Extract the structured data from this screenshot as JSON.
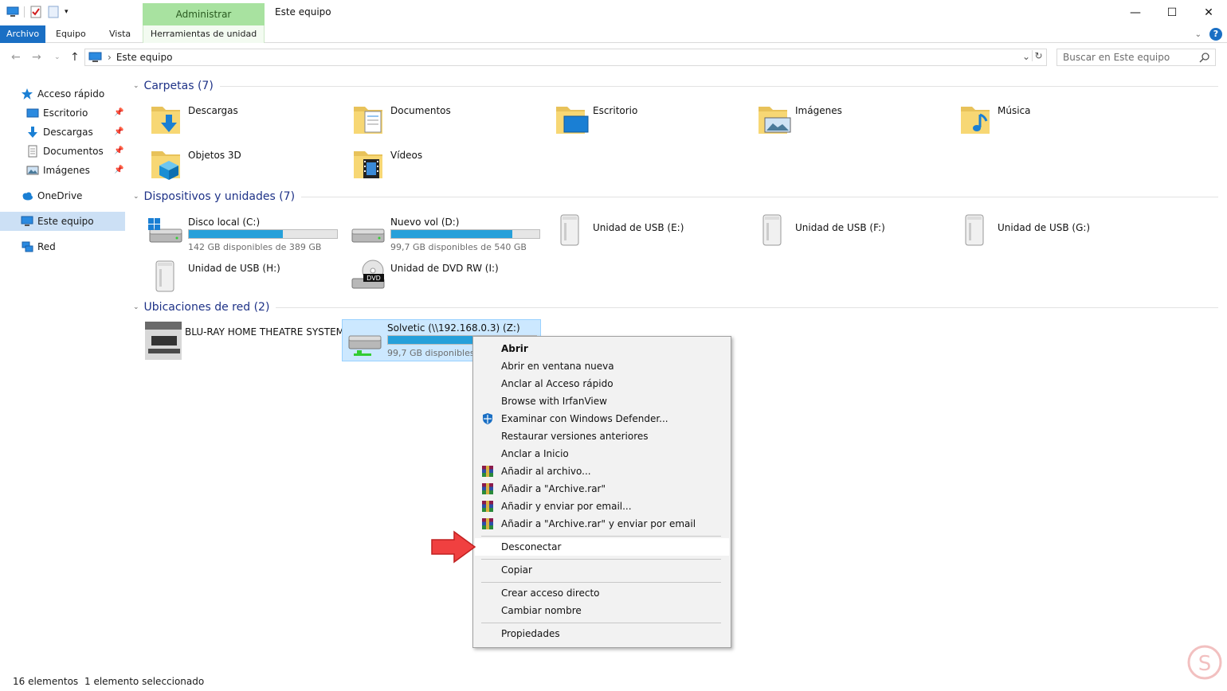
{
  "window": {
    "title": "Este equipo",
    "context_tab_group": "Administrar",
    "minimize": "—",
    "maximize": "☐",
    "close": "✕"
  },
  "ribbon": {
    "tabs": [
      "Archivo",
      "Equipo",
      "Vista",
      "Herramientas de unidad"
    ],
    "help": "?"
  },
  "address": {
    "path": "Este equipo",
    "search_placeholder": "Buscar en Este equipo"
  },
  "sidebar": {
    "items": [
      {
        "label": "Acceso rápido"
      },
      {
        "label": "Escritorio"
      },
      {
        "label": "Descargas"
      },
      {
        "label": "Documentos"
      },
      {
        "label": "Imágenes"
      },
      {
        "label": "OneDrive"
      },
      {
        "label": "Este equipo"
      },
      {
        "label": "Red"
      }
    ]
  },
  "groups": {
    "folders": {
      "header": "Carpetas (7)",
      "items": [
        "Descargas",
        "Documentos",
        "Escritorio",
        "Imágenes",
        "Música",
        "Objetos 3D",
        "Vídeos"
      ]
    },
    "devices": {
      "header": "Dispositivos y unidades (7)",
      "items": [
        {
          "name": "Disco local (C:)",
          "free": "142 GB disponibles de 389 GB",
          "used_fraction": 0.635
        },
        {
          "name": "Nuevo vol (D:)",
          "free": "99,7 GB disponibles de 540 GB",
          "used_fraction": 0.815
        },
        {
          "name": "Unidad de USB (E:)"
        },
        {
          "name": "Unidad de USB (F:)"
        },
        {
          "name": "Unidad de USB (G:)"
        },
        {
          "name": "Unidad de USB (H:)"
        },
        {
          "name": "Unidad de DVD RW (I:)"
        }
      ]
    },
    "network": {
      "header": "Ubicaciones de red (2)",
      "items": [
        {
          "name": "BLU-RAY HOME THEATRE SYSTEM"
        },
        {
          "name": "Solvetic (\\\\192.168.0.3) (Z:)",
          "free": "99,7 GB disponibles",
          "used_fraction": 0.815
        }
      ]
    }
  },
  "context_menu": {
    "items": [
      "Abrir",
      "Abrir en ventana nueva",
      "Anclar al Acceso rápido",
      "Browse with IrfanView",
      "Examinar con Windows Defender...",
      "Restaurar versiones anteriores",
      "Anclar a Inicio",
      "Añadir al archivo...",
      "Añadir a \"Archive.rar\"",
      "Añadir y enviar por email...",
      "Añadir a \"Archive.rar\" y enviar por email",
      "Desconectar",
      "Copiar",
      "Crear acceso directo",
      "Cambiar nombre",
      "Propiedades"
    ]
  },
  "status": {
    "count": "16 elementos",
    "selection": "1 elemento seleccionado"
  },
  "colors": {
    "accent": "#1a6fc4",
    "context_tab": "#a8e2a0",
    "bar_fill": "#26a0da",
    "selection": "#cce8ff",
    "group_header": "#1e3287",
    "arrow": "#f04040"
  }
}
